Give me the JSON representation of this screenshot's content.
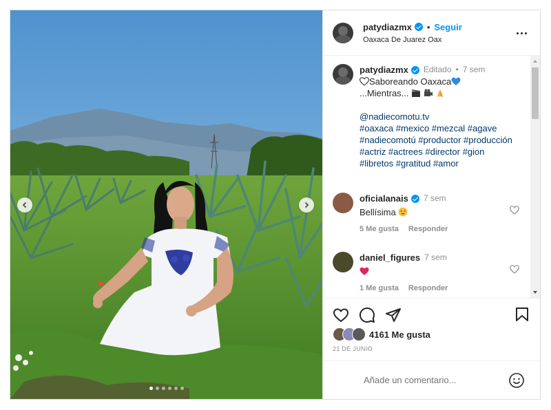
{
  "post": {
    "username": "patydiazmx",
    "follow_label": "Seguir",
    "separator": "•",
    "location": "Oaxaca De Juarez Oax",
    "carousel_dots": 6,
    "carousel_active_index": 0
  },
  "caption": {
    "username": "patydiazmx",
    "edited": "Editado",
    "dot": "•",
    "time": "7 sem",
    "line1": "Saboreando Oaxaca",
    "line2": "...Mientras...",
    "mention": "@nadiecomotu.tv",
    "tags_line1": "#oaxaca #mexico #mezcal #agave",
    "tags_line2": "#nadiecomotú #productor #producción",
    "tags_line3": "#actriz #actrees #director #gion",
    "tags_line4": "#libretos #gratitud #amor"
  },
  "comments": [
    {
      "username": "oficialanais",
      "time": "7 sem",
      "text": "Bellísima",
      "likes": "5 Me gusta",
      "reply": "Responder",
      "avatar_color": "#8a5a44"
    },
    {
      "username": "daniel_figures",
      "time": "7 sem",
      "text": "",
      "likes": "1 Me gusta",
      "reply": "Responder",
      "avatar_color": "#4a4a2a"
    }
  ],
  "footer": {
    "likes": "4161 Me gusta",
    "date": "21 DE JUNIO",
    "comment_placeholder": "Añade un comentario..."
  },
  "colors": {
    "accent": "#0095f6",
    "hashtag": "#00376b",
    "muted": "#8e8e8e",
    "text": "#262626",
    "border": "#dbdbdb"
  },
  "icons": {
    "more": "more-options-icon",
    "heart": "heart-icon",
    "comment": "comment-icon",
    "share": "share-icon",
    "bookmark": "bookmark-icon",
    "emoji": "emoji-icon",
    "verified": "verified-badge-icon"
  }
}
